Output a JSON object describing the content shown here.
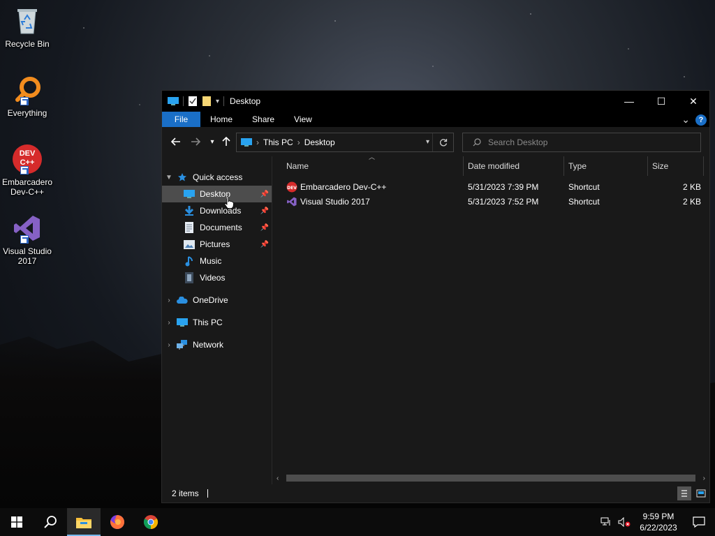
{
  "desktop": {
    "icons": [
      {
        "label": "Recycle Bin",
        "icon": "recycle-bin-icon"
      },
      {
        "label": "Everything",
        "icon": "everything-search-icon"
      },
      {
        "label": "Embarcadero Dev-C++",
        "icon": "devcpp-icon",
        "glyph_text": "DEV C++"
      },
      {
        "label": "Visual Studio 2017",
        "icon": "visual-studio-icon"
      }
    ]
  },
  "window": {
    "title": "Desktop",
    "controls": {
      "minimize": "—",
      "maximize": "☐",
      "close": "✕"
    },
    "ribbon": {
      "tabs": [
        "File",
        "Home",
        "Share",
        "View"
      ],
      "expand": "⌄",
      "help": "?"
    },
    "address": {
      "crumbs": [
        "This PC",
        "Desktop"
      ],
      "separator": "›"
    },
    "search": {
      "placeholder": "Search Desktop"
    },
    "nav": {
      "quick_access": "Quick access",
      "items": [
        {
          "label": "Desktop",
          "pinned": true,
          "selected": true
        },
        {
          "label": "Downloads",
          "pinned": true
        },
        {
          "label": "Documents",
          "pinned": true
        },
        {
          "label": "Pictures",
          "pinned": true
        },
        {
          "label": "Music",
          "pinned": false
        },
        {
          "label": "Videos",
          "pinned": false
        }
      ],
      "onedrive": "OneDrive",
      "this_pc": "This PC",
      "network": "Network"
    },
    "columns": [
      "Name",
      "Date modified",
      "Type",
      "Size"
    ],
    "files": [
      {
        "name": "Embarcadero Dev-C++",
        "date": "5/31/2023 7:39 PM",
        "type": "Shortcut",
        "size": "2 KB"
      },
      {
        "name": "Visual Studio 2017",
        "date": "5/31/2023 7:52 PM",
        "type": "Shortcut",
        "size": "2 KB"
      }
    ],
    "status": {
      "items": "2 items"
    }
  },
  "taskbar": {
    "clock_time": "9:59 PM",
    "clock_date": "6/22/2023"
  },
  "colors": {
    "accent": "#1a6fc7",
    "selection": "#4d4d4d",
    "window_bg": "#191919",
    "titlebar_bg": "#000000"
  }
}
